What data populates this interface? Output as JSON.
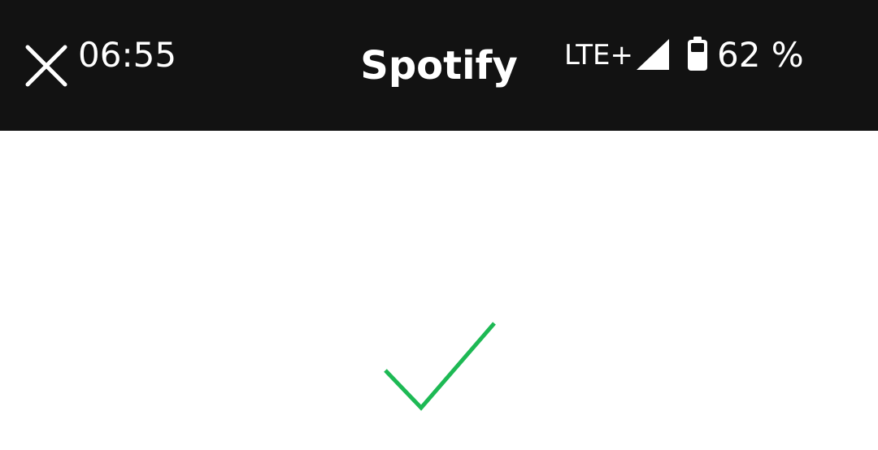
{
  "status_bar": {
    "time": "06:55",
    "network": "LTE+",
    "battery_percent": "62 %",
    "battery_level": 0.62,
    "icons": [
      "close-icon",
      "signal-icon",
      "battery-icon"
    ]
  },
  "header": {
    "title": "Spotify"
  },
  "main": {
    "status_icon": "checkmark-icon",
    "accent_color": "#1DB954"
  },
  "colors": {
    "topbar_background": "#121212",
    "page_background": "#FFFFFF",
    "topbar_text": "#FFFFFF"
  }
}
